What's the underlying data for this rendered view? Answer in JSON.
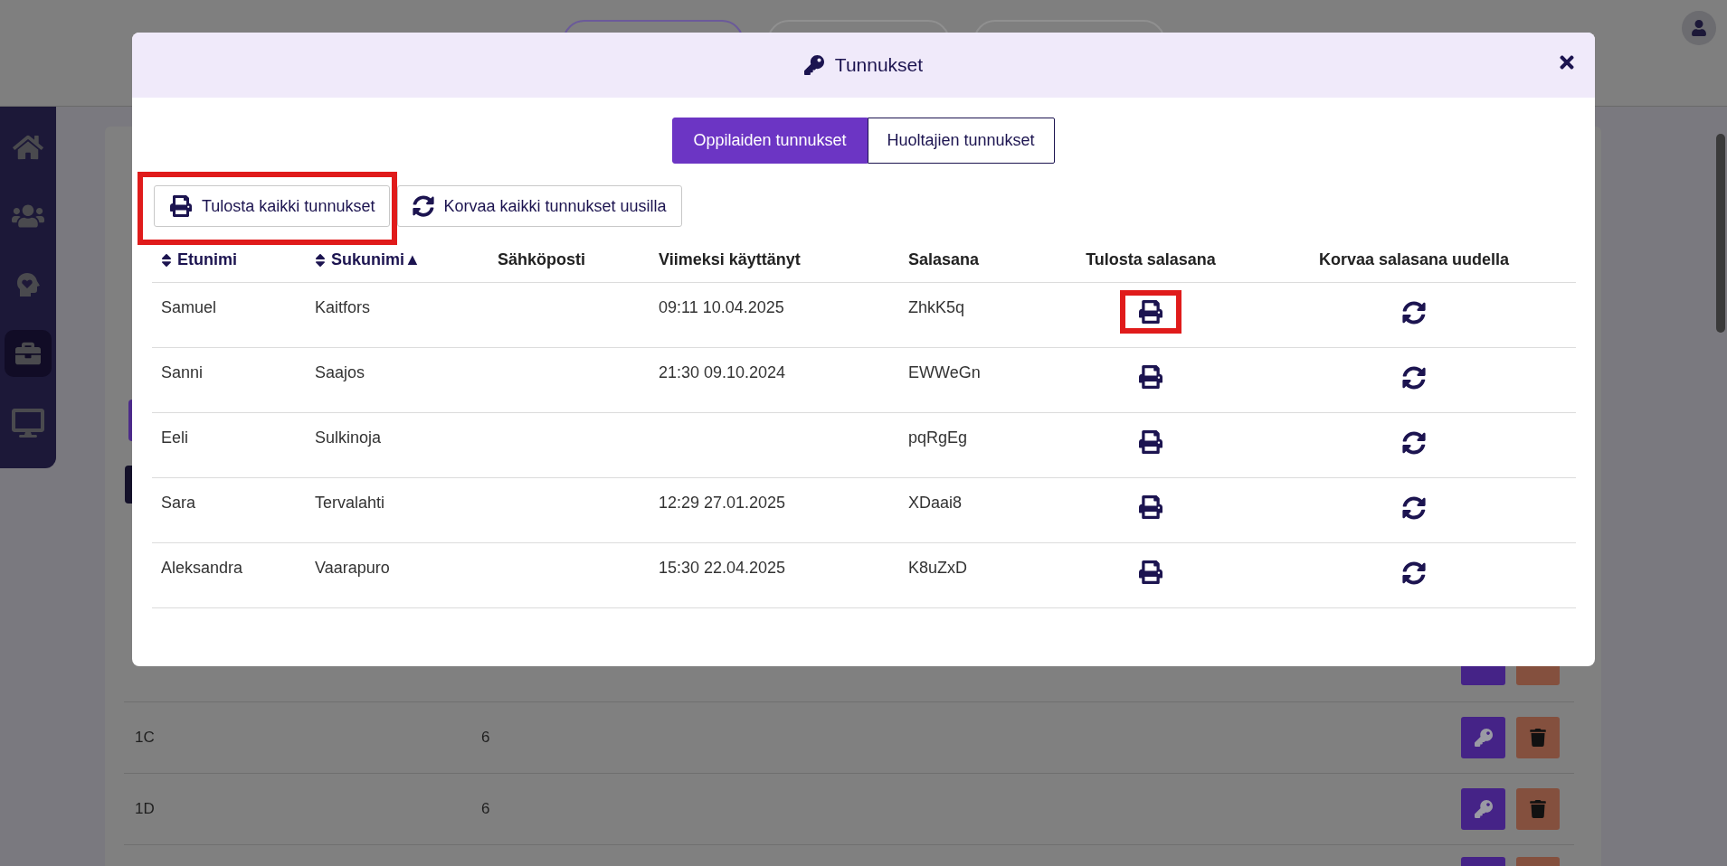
{
  "background": {
    "rows": [
      {
        "name": "1C",
        "count": "6"
      },
      {
        "name": "1D",
        "count": "6"
      }
    ]
  },
  "dialog": {
    "title": "Tunnukset",
    "tabs": [
      {
        "label": "Oppilaiden tunnukset",
        "selected": true
      },
      {
        "label": "Huoltajien tunnukset",
        "selected": false
      }
    ],
    "actions": [
      {
        "kind": "print",
        "label": "Tulosta kaikki tunnukset",
        "highlighted": true
      },
      {
        "kind": "replace",
        "label": "Korvaa kaikki tunnukset uusilla",
        "highlighted": false
      }
    ],
    "columns": [
      {
        "label": "Etunimi",
        "sortable": true
      },
      {
        "label": "Sukunimi",
        "sortable": true,
        "sort_indicator": "▲"
      },
      {
        "label": "Sähköposti",
        "sortable": false
      },
      {
        "label": "Viimeksi käyttänyt",
        "sortable": false
      },
      {
        "label": "Salasana",
        "sortable": false
      },
      {
        "label": "Tulosta salasana",
        "sortable": false
      },
      {
        "label": "Korvaa salasana uudella",
        "sortable": false
      }
    ],
    "rows": [
      {
        "first_name": "Samuel",
        "last_name": "Kaitfors",
        "last_used": "09:11 10.04.2025",
        "password": "ZhkK5q",
        "print_highlighted": true
      },
      {
        "first_name": "Sanni",
        "last_name": "Saajos",
        "last_used": "21:30 09.10.2024",
        "password": "EWWeGn",
        "print_highlighted": false
      },
      {
        "first_name": "Eeli",
        "last_name": "Sulkinoja",
        "password": "pqRgEg",
        "print_highlighted": false
      },
      {
        "first_name": "Sara",
        "last_name": "Tervalahti",
        "last_used": "12:29 27.01.2025",
        "password": "XDaai8",
        "print_highlighted": false
      },
      {
        "first_name": "Aleksandra",
        "last_name": "Vaarapuro",
        "last_used": "15:30 22.04.2025",
        "password": "K8uZxD",
        "print_highlighted": false
      }
    ]
  }
}
